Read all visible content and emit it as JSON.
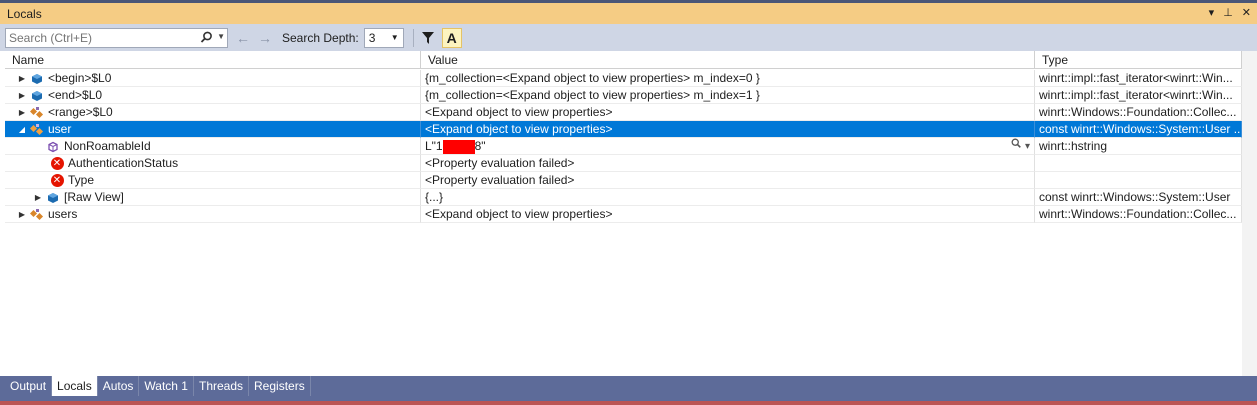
{
  "window": {
    "title": "Locals",
    "buttons": [
      "▾",
      "⊥",
      "✕"
    ]
  },
  "toolbar": {
    "search_placeholder": "Search (Ctrl+E)",
    "back_arrow": "←",
    "forward_arrow": "→",
    "depth_label": "Search Depth:",
    "depth_value": "3",
    "filter_icon": "▼",
    "aa_label": "A"
  },
  "columns": [
    "Name",
    "Value",
    "Type"
  ],
  "rows": [
    {
      "name": "<begin>$L0",
      "value": "{m_collection=<Expand object to view properties> m_index=0 }",
      "type": "winrt::impl::fast_iterator<winrt::Win..."
    },
    {
      "name": "<end>$L0",
      "value": "{m_collection=<Expand object to view properties> m_index=1 }",
      "type": "winrt::impl::fast_iterator<winrt::Win..."
    },
    {
      "name": "<range>$L0",
      "value": "<Expand object to view properties>",
      "type": "winrt::Windows::Foundation::Collec..."
    },
    {
      "name": "user",
      "value": "<Expand object to view properties>",
      "type": "const winrt::Windows::System::User ..."
    },
    {
      "name": "NonRoamableId",
      "value_prefix": "L\"1",
      "value_suffix": "8\"",
      "type": "winrt::hstring"
    },
    {
      "name": "AuthenticationStatus",
      "value": "<Property evaluation failed>",
      "type": ""
    },
    {
      "name": "Type",
      "value": "<Property evaluation failed>",
      "type": ""
    },
    {
      "name": "[Raw View]",
      "value": "{...}",
      "type": "const winrt::Windows::System::User"
    },
    {
      "name": "users",
      "value": "<Expand object to view properties>",
      "type": "winrt::Windows::Foundation::Collec..."
    }
  ],
  "tabs": [
    "Output",
    "Locals",
    "Autos",
    "Watch 1",
    "Threads",
    "Registers"
  ],
  "colors": {
    "selection": "#0078d7",
    "title_bar": "#f5cc84",
    "chrome": "#5d6b99",
    "error": "#e51400"
  }
}
